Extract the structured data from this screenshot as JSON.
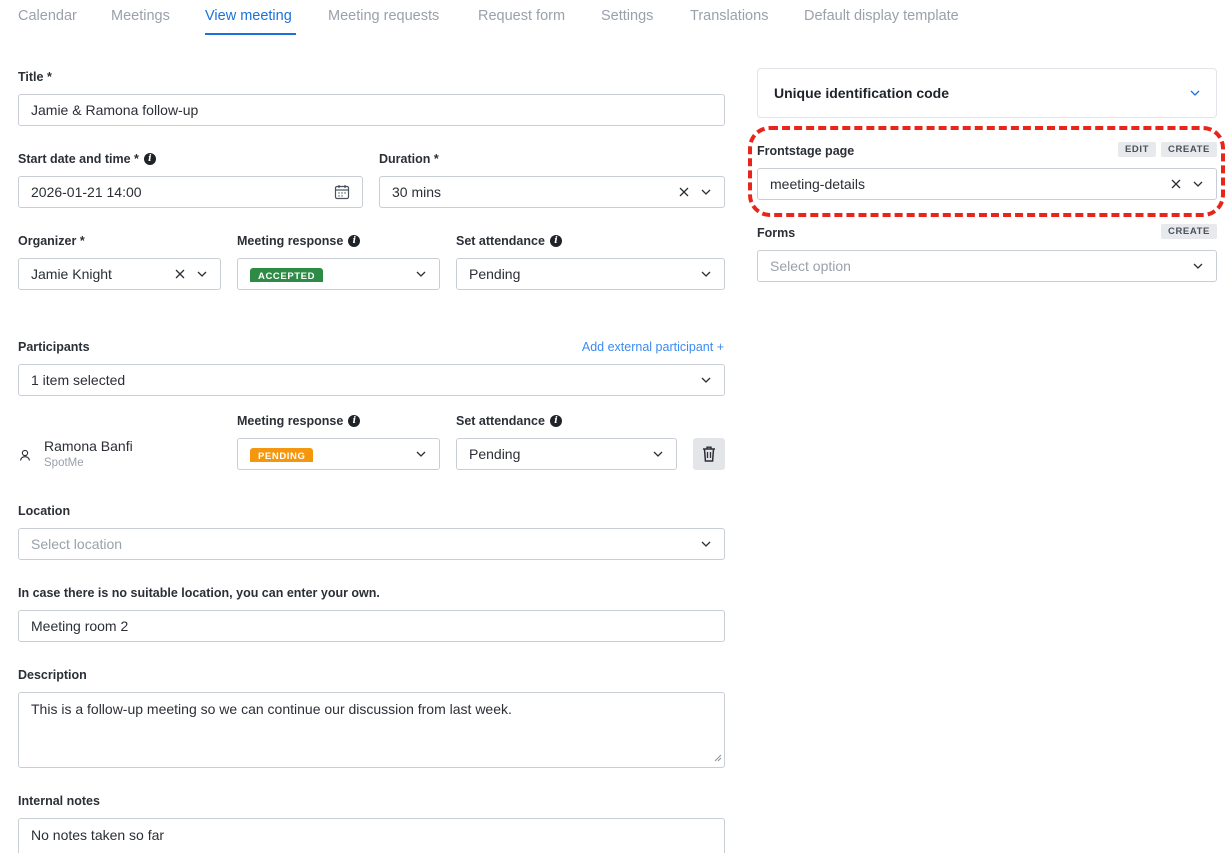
{
  "tabs": [
    {
      "label": "Calendar"
    },
    {
      "label": "Meetings"
    },
    {
      "label": "View meeting",
      "active": true
    },
    {
      "label": "Meeting requests"
    },
    {
      "label": "Request form"
    },
    {
      "label": "Settings"
    },
    {
      "label": "Translations"
    },
    {
      "label": "Default display template"
    }
  ],
  "form": {
    "title_label": "Title *",
    "title_value": "Jamie & Ramona follow-up",
    "start_label": "Start date and time *",
    "start_value": "2026-01-21 14:00",
    "duration_label": "Duration *",
    "duration_value": "30 mins",
    "organizer_label": "Organizer *",
    "organizer_value": "Jamie Knight",
    "meeting_response_label": "Meeting response",
    "organizer_response": "ACCEPTED",
    "set_attendance_label": "Set attendance",
    "organizer_attendance": "Pending",
    "participants_label": "Participants",
    "add_external": "Add external participant +",
    "participants_value": "1 item selected",
    "participant": {
      "name": "Ramona Banfi",
      "company": "SpotMe",
      "response": "PENDING",
      "attendance": "Pending"
    },
    "location_label": "Location",
    "location_placeholder": "Select location",
    "custom_location_label": "In case there is no suitable location, you can enter your own.",
    "custom_location_value": "Meeting room 2",
    "description_label": "Description",
    "description_value": "This is a follow-up meeting so we can continue our discussion from last week.",
    "notes_label": "Internal notes",
    "notes_value": "No notes taken so far"
  },
  "sidebar": {
    "uid_title": "Unique identification code",
    "frontstage_label": "Frontstage page",
    "edit_label": "EDIT",
    "create_label": "CREATE",
    "frontstage_value": "meeting-details",
    "forms_label": "Forms",
    "forms_create_label": "CREATE",
    "forms_placeholder": "Select option"
  },
  "colors": {
    "accent": "#1a73d9",
    "accepted": "#2e8b45",
    "pending": "#f5960f",
    "annotation": "#e8251a"
  }
}
